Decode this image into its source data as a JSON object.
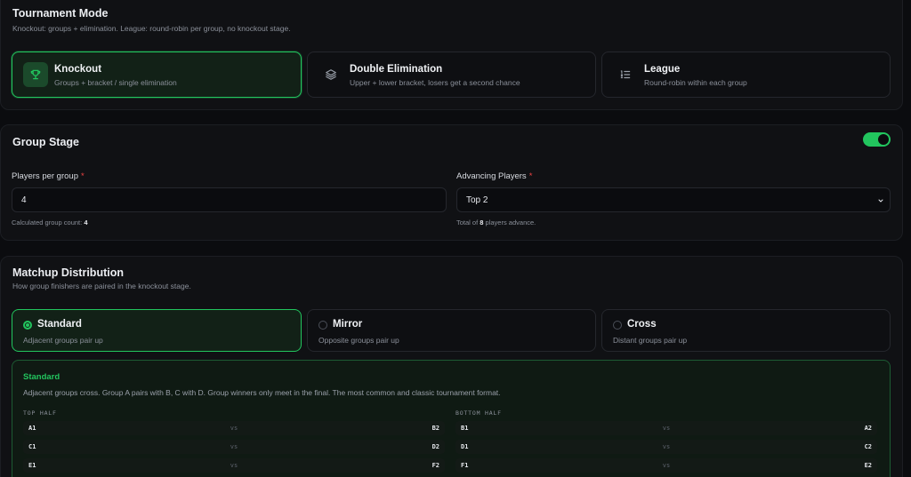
{
  "tournament_mode": {
    "title": "Tournament Mode",
    "subtitle": "Knockout: groups + elimination. League: round-robin per group, no knockout stage.",
    "options": [
      {
        "name": "Knockout",
        "desc": "Groups + bracket / single elimination",
        "icon": "trophy-icon",
        "selected": true
      },
      {
        "name": "Double Elimination",
        "desc": "Upper + lower bracket, losers get a second chance",
        "icon": "layers-icon",
        "selected": false
      },
      {
        "name": "League",
        "desc": "Round-robin within each group",
        "icon": "list-ordered-icon",
        "selected": false
      }
    ]
  },
  "group_stage": {
    "title": "Group Stage",
    "enabled": true,
    "players_per_group": {
      "label": "Players per group",
      "required_mark": "*",
      "value": "4",
      "hint_prefix": "Calculated group count:",
      "hint_value": "4"
    },
    "advancing": {
      "label": "Advancing Players",
      "required_mark": "*",
      "value": "Top 2",
      "hint_prefix": "Total of",
      "hint_value": "8",
      "hint_suffix": "players advance."
    }
  },
  "matchup": {
    "title": "Matchup Distribution",
    "subtitle": "How group finishers are paired in the knockout stage.",
    "options": [
      {
        "name": "Standard",
        "desc": "Adjacent groups pair up",
        "selected": true
      },
      {
        "name": "Mirror",
        "desc": "Opposite groups pair up",
        "selected": false
      },
      {
        "name": "Cross",
        "desc": "Distant groups pair up",
        "selected": false
      }
    ],
    "detail": {
      "title": "Standard",
      "text": "Adjacent groups cross. Group A pairs with B, C with D. Group winners only meet in the final. The most common and classic tournament format.",
      "top_half_label": "TOP HALF",
      "bottom_half_label": "BOTTOM HALF",
      "vs": "vs",
      "top_half": [
        [
          "A1",
          "B2"
        ],
        [
          "C1",
          "D2"
        ],
        [
          "E1",
          "F2"
        ]
      ],
      "bottom_half": [
        [
          "B1",
          "A2"
        ],
        [
          "D1",
          "C2"
        ],
        [
          "F1",
          "E2"
        ]
      ]
    }
  },
  "colors": {
    "accent": "#22c55e",
    "required": "#ef4444"
  }
}
